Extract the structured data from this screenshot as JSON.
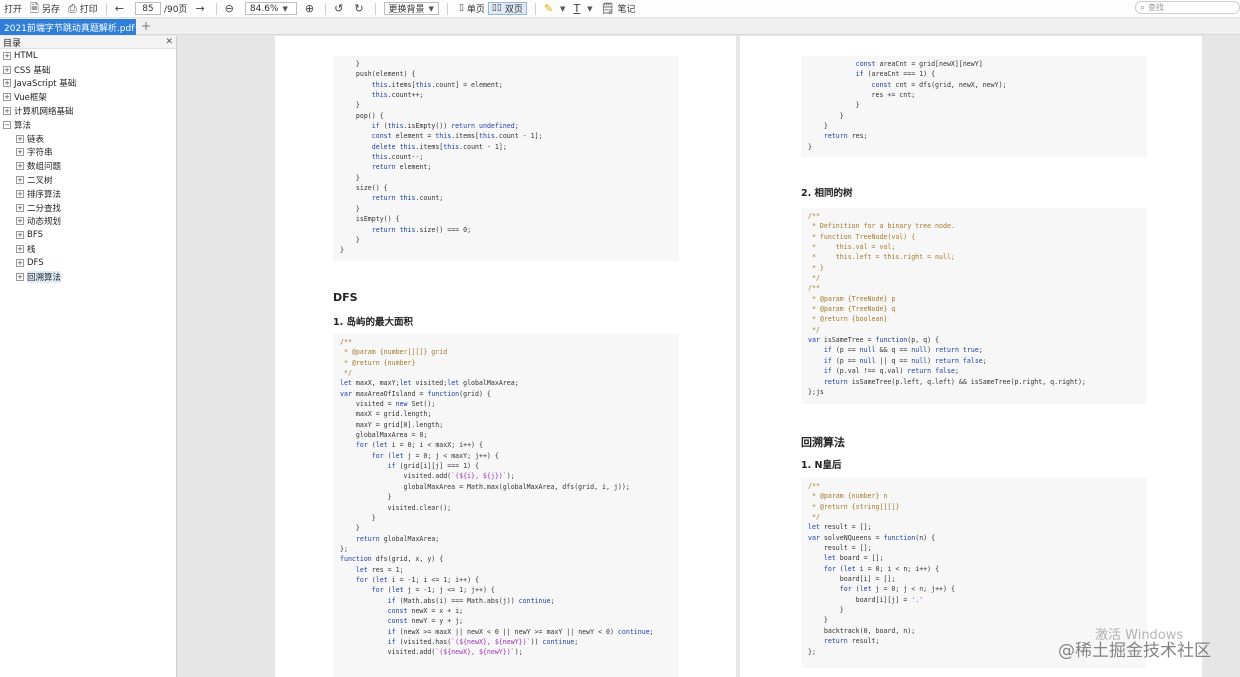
{
  "toolbar": {
    "open": "打开",
    "save_as": "另存",
    "print": "打印",
    "page_current": "85",
    "page_total": "/90页",
    "zoom": "84.6%",
    "background": "更换背景",
    "single_page": "单页",
    "double_page": "双页",
    "notes": "笔记",
    "search_placeholder": "查找"
  },
  "tab": {
    "title": "2021前端字节跳动真题解析.pdf"
  },
  "sidebar": {
    "title": "目录",
    "items": [
      {
        "label": "HTML",
        "level": 0
      },
      {
        "label": "CSS 基础",
        "level": 0
      },
      {
        "label": "JavaScript 基础",
        "level": 0
      },
      {
        "label": "Vue框架",
        "level": 0
      },
      {
        "label": "计算机网络基础",
        "level": 0
      },
      {
        "label": "算法",
        "level": 0,
        "expanded": true
      },
      {
        "label": "链表",
        "level": 1
      },
      {
        "label": "字符串",
        "level": 1
      },
      {
        "label": "数组问题",
        "level": 1
      },
      {
        "label": "二叉树",
        "level": 1
      },
      {
        "label": "排序算法",
        "level": 1
      },
      {
        "label": "二分查找",
        "level": 1
      },
      {
        "label": "动态规划",
        "level": 1
      },
      {
        "label": "BFS",
        "level": 1
      },
      {
        "label": "栈",
        "level": 1
      },
      {
        "label": "DFS",
        "level": 1
      },
      {
        "label": "回溯算法",
        "level": 1,
        "active": true
      }
    ]
  },
  "page1": {
    "code1": [
      "    }",
      "    push(element) {",
      "        this.items[this.count] = element;",
      "        this.count++;",
      "    }",
      "    pop() {",
      "        if (this.isEmpty()) return undefined;",
      "        const element = this.items[this.count - 1];",
      "        delete this.items[this.count - 1];",
      "        this.count--;",
      "        return element;",
      "    }",
      "    size() {",
      "        return this.count;",
      "    }",
      "    isEmpty() {",
      "        return this.size() === 0;",
      "    }",
      "}"
    ],
    "heading_dfs": "DFS",
    "heading_island": "1. 岛屿的最大面积",
    "code2": [
      "/**",
      " * @param {number[][]} grid",
      " * @return {number}",
      " */",
      "let maxX, maxY;let visited;let globalMaxArea;",
      "var maxAreaOfIsland = function(grid) {",
      "    visited = new Set();",
      "    maxX = grid.length;",
      "    maxY = grid[0].length;",
      "    globalMaxArea = 0;",
      "    for (let i = 0; i < maxX; i++) {",
      "        for (let j = 0; j < maxY; j++) {",
      "            if (grid[i][j] === 1) {",
      "                visited.add(`(${i}, ${j})`);",
      "                globalMaxArea = Math.max(globalMaxArea, dfs(grid, i, j));",
      "            }",
      "            visited.clear();",
      "        }",
      "    }",
      "    return globalMaxArea;",
      "};",
      "function dfs(grid, x, y) {",
      "    let res = 1;",
      "    for (let i = -1; i <= 1; i++) {",
      "        for (let j = -1; j <= 1; j++) {",
      "            if (Math.abs(i) === Math.abs(j)) continue;",
      "            const newX = x + i;",
      "            const newY = y + j;",
      "            if (newX >= maxX || newX < 0 || newY >= maxY || newY < 0) continue;",
      "            if (visited.has(`(${newX}, ${newY})`)) continue;",
      "            visited.add(`(${newX}, ${newY})`);"
    ]
  },
  "page2": {
    "code1": [
      "            const areaCnt = grid[newX][newY]",
      "            if (areaCnt === 1) {",
      "                const cnt = dfs(grid, newX, newY);",
      "                res += cnt;",
      "            }",
      "        }",
      "    }",
      "    return res;",
      "}"
    ],
    "heading_same_tree": "2. 相同的树",
    "code2": [
      "/**",
      " * Definition for a binary tree node.",
      " * function TreeNode(val) {",
      " *     this.val = val;",
      " *     this.left = this.right = null;",
      " * }",
      " */",
      "/**",
      " * @param {TreeNode} p",
      " * @param {TreeNode} q",
      " * @return {boolean}",
      " */",
      "var isSameTree = function(p, q) {",
      "    if (p == null && q == null) return true;",
      "    if (p == null || q == null) return false;",
      "    if (p.val !== q.val) return false;",
      "    return isSameTree(p.left, q.left) && isSameTree(p.right, q.right);",
      "};js"
    ],
    "heading_backtrack": "回溯算法",
    "heading_nqueens": "1. N皇后",
    "code3": [
      "/**",
      " * @param {number} n",
      " * @return {string[][]}",
      " */",
      "let result = [];",
      "var solveNQueens = function(n) {",
      "    result = [];",
      "    let board = [];",
      "    for (let i = 0; i < n; i++) {",
      "        board[i] = [];",
      "        for (let j = 0; j < n; j++) {",
      "            board[i][j] = '.'",
      "        }",
      "    }",
      "    backtrack(0, board, n);",
      "    return result;",
      "};"
    ]
  },
  "watermark": {
    "windows": "激活 Windows",
    "site": "@稀土掘金技术社区"
  }
}
